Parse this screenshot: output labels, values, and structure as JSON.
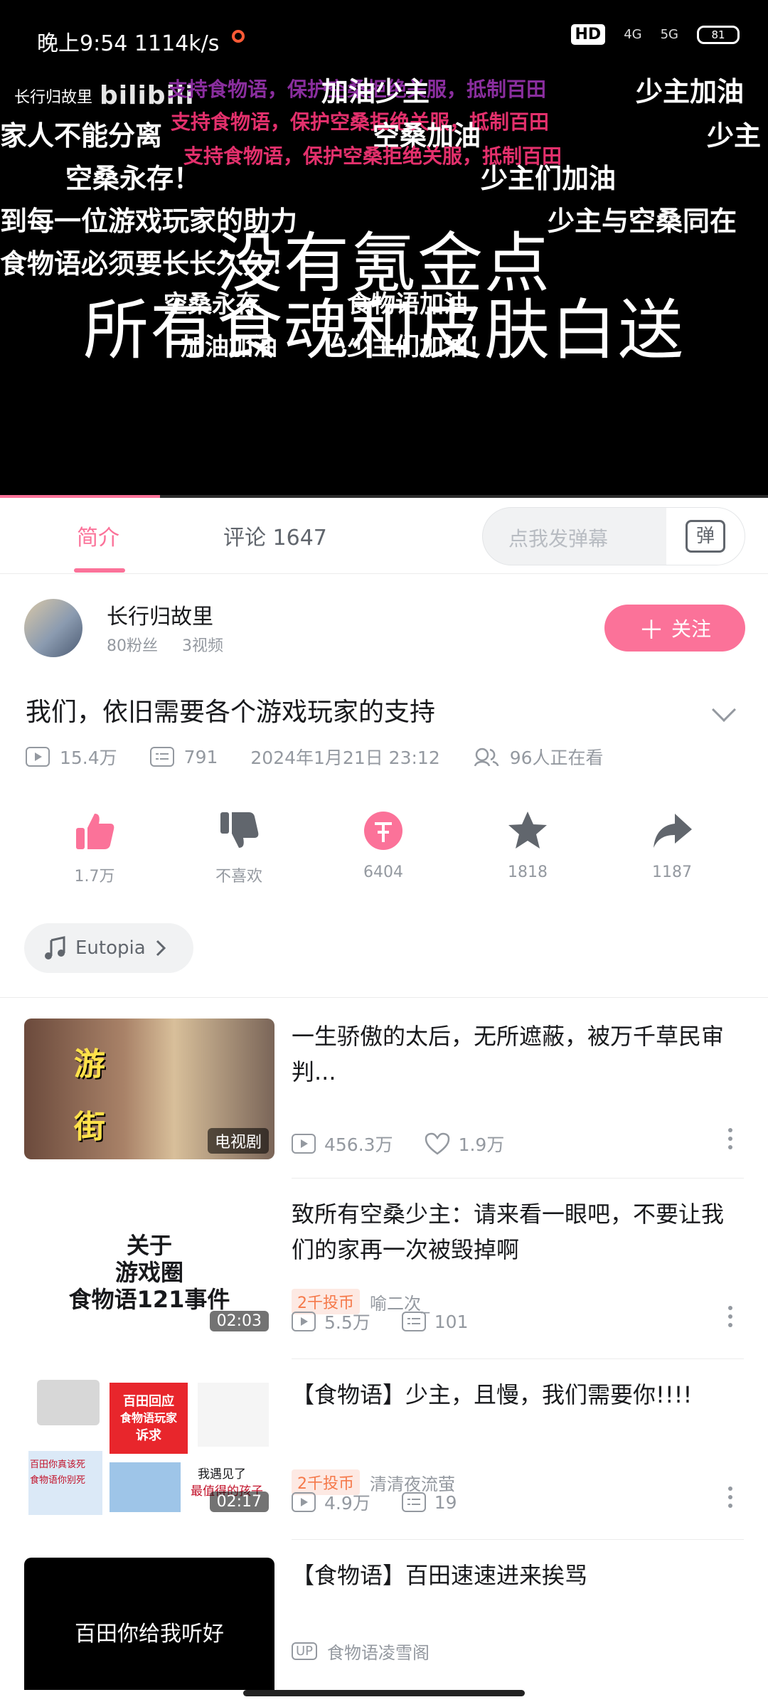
{
  "status": {
    "time": "晚上9:54 1114k/s",
    "hd": "HD",
    "net1": "4G",
    "net2": "5G",
    "battery": "81"
  },
  "watermark": {
    "uploader": "长行归故里",
    "logo": "bilibili"
  },
  "danmaku": [
    "支持食物语，保护空桑拒绝关服，抵制百田",
    "加油少主",
    "少主加油",
    "家人不能分离",
    "支持食物语，保护空桑拒绝关服，抵制百田",
    "空桑加油",
    "少主",
    "支持食物语，保护空桑拒绝关服，抵制百田",
    "空桑永存！",
    "少主们加油",
    "到每一位游戏玩家的助力",
    "少主与空桑同在",
    "食物语必须要长长久久！",
    "空桑永存",
    "食物语加油",
    "加油加油",
    "少主们加油！"
  ],
  "caption": {
    "line1": "没有氪金点",
    "line2": "所有食魂和皮肤白送"
  },
  "tabs": {
    "intro": "简介",
    "comments": "评论 1647"
  },
  "danmaku_input": {
    "placeholder": "点我发弹幕",
    "button": "弹"
  },
  "uploader": {
    "name": "长行归故里",
    "fans": "80粉丝",
    "videos": "3视频",
    "follow": "关注"
  },
  "video": {
    "title": "我们，依旧需要各个游戏玩家的支持",
    "views": "15.4万",
    "danmaku_count": "791",
    "date": "2024年1月21日 23:12",
    "watching": "96人正在看"
  },
  "actions": {
    "like": "1.7万",
    "dislike": "不喜欢",
    "coin": "6404",
    "fav": "1818",
    "share": "1187"
  },
  "music": {
    "name": "Eutopia"
  },
  "recommendations": [
    {
      "title": "一生骄傲的太后，无所遮蔽，被万千草民审判...",
      "badge": "电视剧",
      "thumb_text": [
        "游",
        "街"
      ],
      "views": "456.3万",
      "likes": "1.9万"
    },
    {
      "title": "致所有空桑少主：请来看一眼吧，不要让我们的家再一次被毁掉啊",
      "tag": "2千投币",
      "author": "喻二次_",
      "thumb_text": [
        "关于",
        "游戏圈",
        "食物语121事件"
      ],
      "duration": "02:03",
      "views": "5.5万",
      "danmaku": "101"
    },
    {
      "title": "【食物语】少主，且慢，我们需要你!!!!",
      "tag": "2千投币",
      "author": "清清夜流萤",
      "thumb_text": [
        "百田回应",
        "食物语玩家",
        "诉求",
        "百田你真该死",
        "食物语你别死",
        "我遇见了",
        "最值得的孩子"
      ],
      "duration": "02:17",
      "views": "4.9万",
      "danmaku": "19"
    },
    {
      "title": "【食物语】百田速速进来挨骂",
      "author": "食物语凌雪阁",
      "thumb_text": [
        "百田你给我听好"
      ]
    }
  ],
  "colors": {
    "accent": "#fb7299",
    "muted": "#9499a0",
    "coin_tag": "#f5794a"
  }
}
